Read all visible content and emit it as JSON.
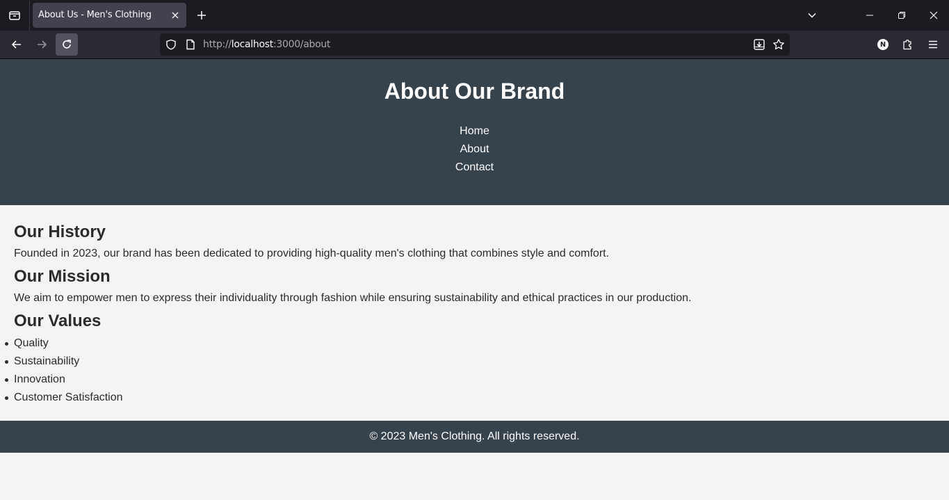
{
  "browser": {
    "tab_title": "About Us - Men's Clothing",
    "url_prefix": "http://",
    "url_host": "localhost",
    "url_rest": ":3000/about",
    "profile_initial": "N"
  },
  "header": {
    "title": "About Our Brand",
    "nav": [
      "Home",
      "About",
      "Contact"
    ]
  },
  "sections": {
    "history": {
      "title": "Our History",
      "text": "Founded in 2023, our brand has been dedicated to providing high-quality men's clothing that combines style and comfort."
    },
    "mission": {
      "title": "Our Mission",
      "text": "We aim to empower men to express their individuality through fashion while ensuring sustainability and ethical practices in our production."
    },
    "values": {
      "title": "Our Values",
      "items": [
        "Quality",
        "Sustainability",
        "Innovation",
        "Customer Satisfaction"
      ]
    }
  },
  "footer": {
    "text": "© 2023 Men's Clothing. All rights reserved."
  },
  "colors": {
    "header_bg": "#37434c",
    "page_bg": "#f4f4f4",
    "text": "#2b2b2b"
  }
}
